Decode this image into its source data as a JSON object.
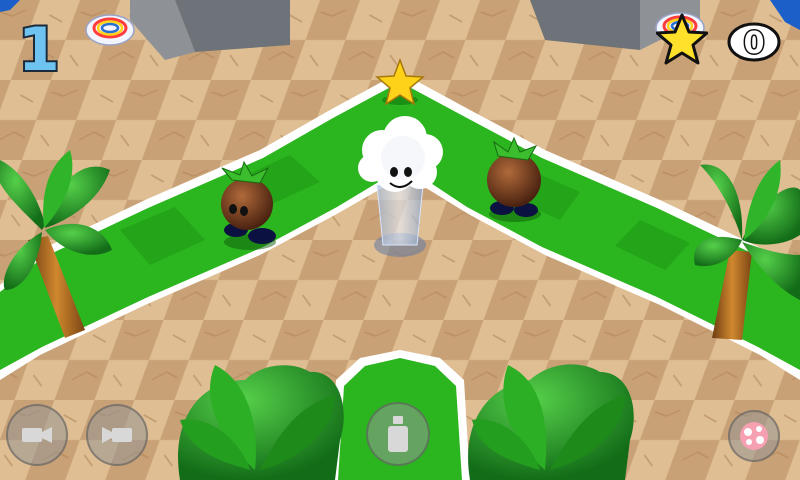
{
  "hud": {
    "lives": "1",
    "stars_collected": "0",
    "icons": {
      "lives": "lives-counter",
      "disc_left": "rainbow-disc-icon",
      "disc_right": "rainbow-disc-icon",
      "star": "star-icon",
      "count": "star-count"
    }
  },
  "controls": {
    "camera_left": "camera-rotate-left-icon",
    "camera_right": "camera-rotate-right-icon",
    "jump": "jump-icon",
    "special": "pink-ability-icon"
  },
  "colors": {
    "path_green": "#2bb51f",
    "floor_tile_light": "#e9c69a",
    "floor_tile_dark": "#cfa477",
    "lives_blue": "#6ec3f0",
    "star_yellow": "#ffe02a"
  }
}
